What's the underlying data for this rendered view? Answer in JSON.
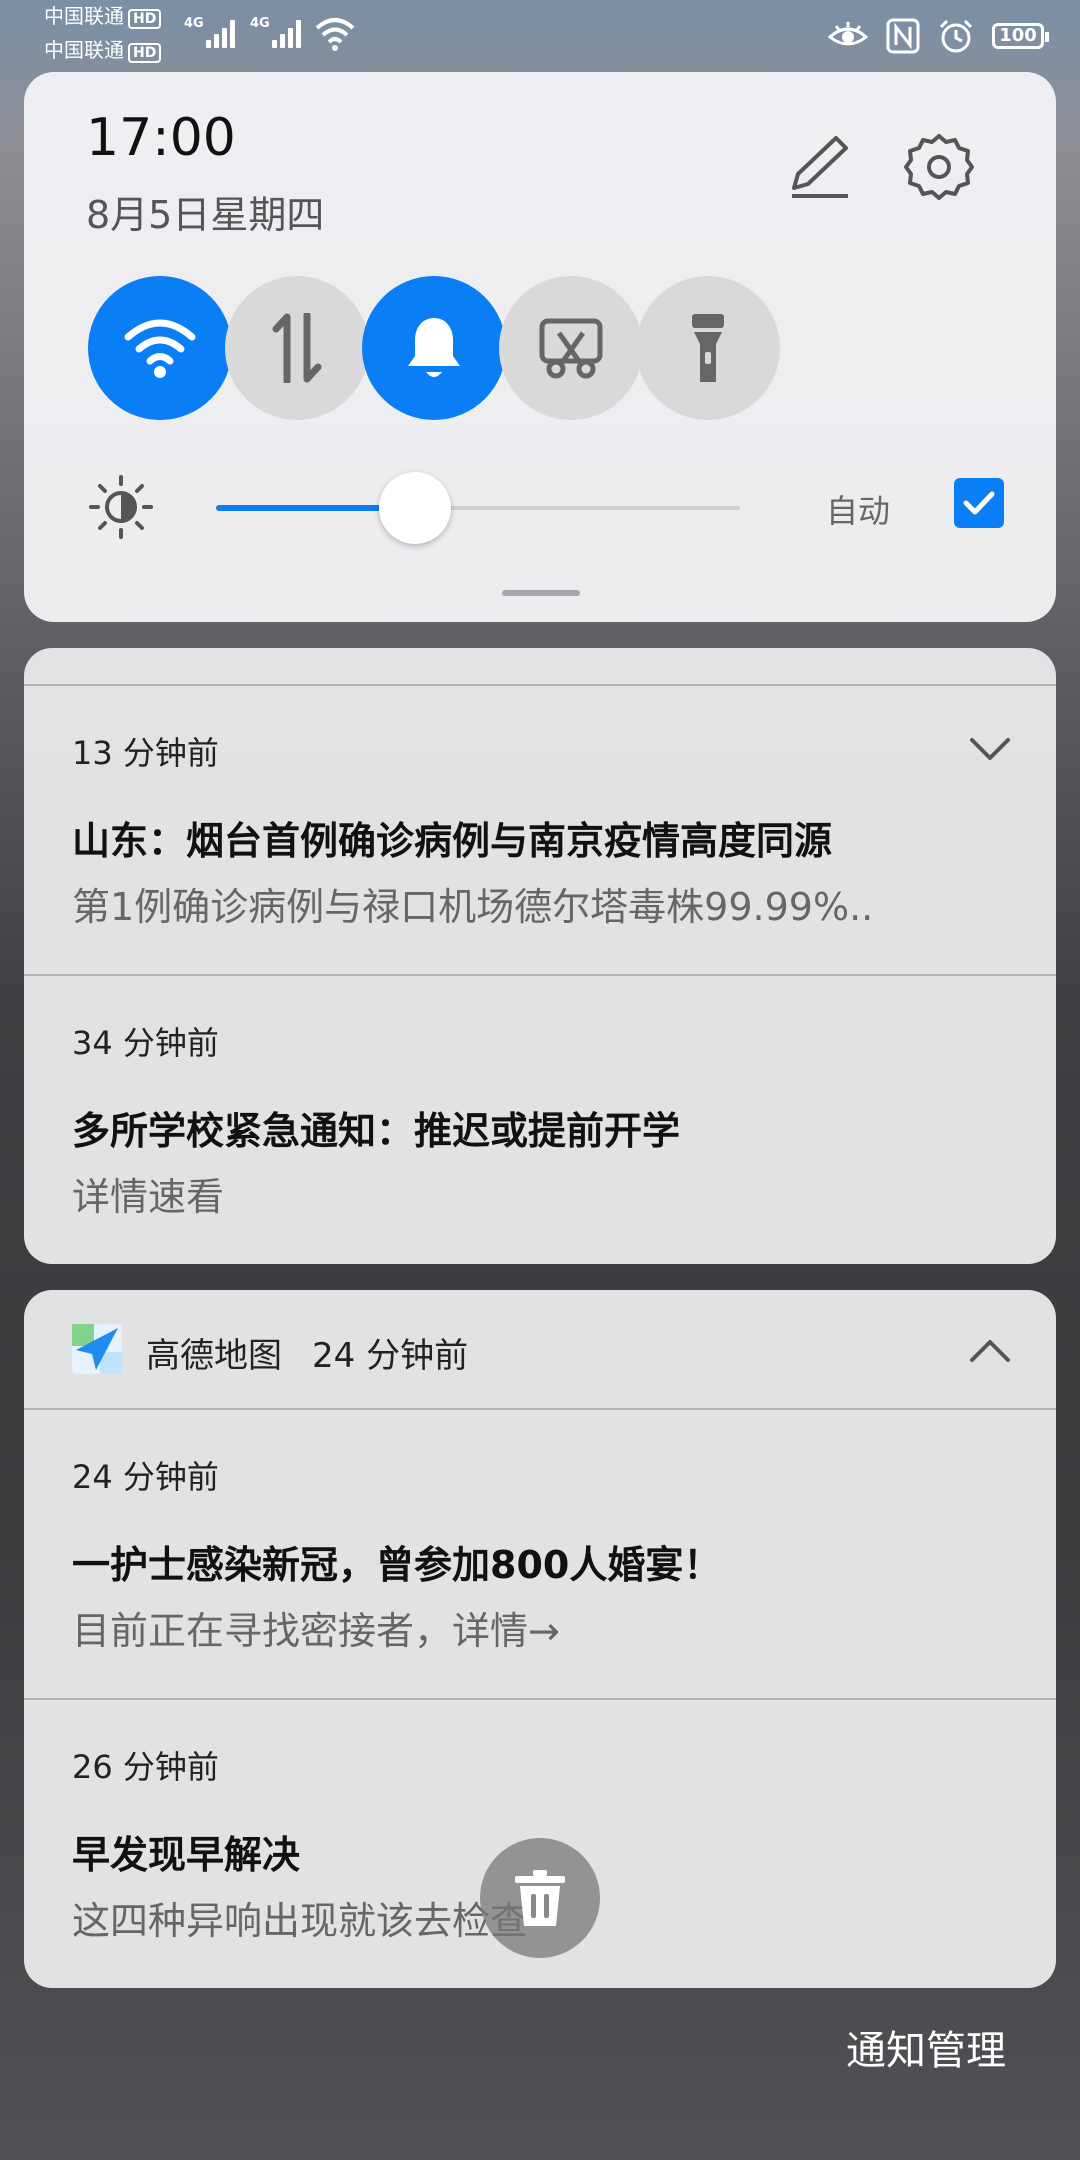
{
  "status_bar": {
    "carrier1": "中国联通",
    "carrier2": "中国联通",
    "hd": "HD",
    "network": "4G",
    "battery": "100"
  },
  "quick_settings": {
    "time": "17:00",
    "date": "8月5日星期四",
    "tiles": [
      {
        "icon": "wifi-icon",
        "active": true
      },
      {
        "icon": "mobile-data-icon",
        "active": false
      },
      {
        "icon": "bell-icon",
        "active": true
      },
      {
        "icon": "screenshot-icon",
        "active": false
      },
      {
        "icon": "flashlight-icon",
        "active": false
      }
    ],
    "brightness_level": 0.38,
    "auto_label": "自动",
    "auto_checked": true
  },
  "card1": {
    "notifications": [
      {
        "time": "13 分钟前",
        "title": "山东：烟台首例确诊病例与南京疫情高度同源",
        "body": "第1例确诊病例与禄口机场德尔塔毒株99.99%.."
      },
      {
        "time": "34 分钟前",
        "title": "多所学校紧急通知：推迟或提前开学",
        "body": "详情速看"
      }
    ]
  },
  "card2": {
    "app_name": "高德地图",
    "app_time": "24 分钟前",
    "notifications": [
      {
        "time": "24 分钟前",
        "title": "一护士感染新冠，曾参加800人婚宴！",
        "body": "目前正在寻找密接者，详情→"
      },
      {
        "time": "26 分钟前",
        "title": "早发现早解决",
        "body": "这四种异响出现就该去检查"
      }
    ]
  },
  "footer": {
    "manage_label": "通知管理"
  },
  "colors": {
    "accent": "#0a7ef5"
  }
}
